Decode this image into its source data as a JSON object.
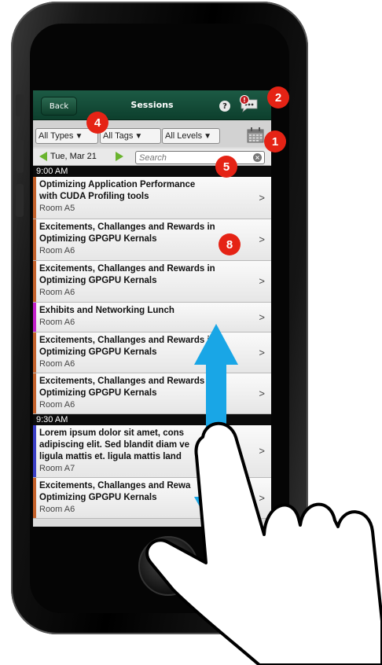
{
  "navbar": {
    "back_label": "Back",
    "title": "Sessions",
    "help_label": "?",
    "chat_badge_count": "!"
  },
  "filters": {
    "types": "All Types",
    "tags": "All Tags",
    "levels": "All Levels",
    "caret": "▼"
  },
  "date_bar": {
    "date": "Tue, Mar 21",
    "search_placeholder": "Search",
    "clear_label": "×"
  },
  "groups": [
    {
      "time": "9:00 AM",
      "sessions": [
        {
          "title_line1": "Optimizing Application Performance",
          "title_line2": "with CUDA Profiling tools",
          "title_line3": "",
          "room": "Room A5",
          "color": "#c4612a"
        },
        {
          "title_line1": "Excitements, Challanges and Rewards in",
          "title_line2": "Optimizing GPGPU Kernals",
          "title_line3": "",
          "room": "Room A6",
          "color": "#c4612a"
        },
        {
          "title_line1": "Excitements, Challanges and Rewards in",
          "title_line2": "Optimizing GPGPU Kernals",
          "title_line3": "",
          "room": "Room A6",
          "color": "#c4612a"
        },
        {
          "title_line1": "Exhibits and Networking Lunch",
          "title_line2": "",
          "title_line3": "",
          "room": "Room A6",
          "color": "#c21fc9"
        },
        {
          "title_line1": "Excitements, Challanges and Rewards in",
          "title_line2": "Optimizing GPGPU Kernals",
          "title_line3": "",
          "room": "Room A6",
          "color": "#c4612a"
        },
        {
          "title_line1": "Excitements, Challanges and Rewards in",
          "title_line2": "Optimizing GPGPU Kernals",
          "title_line3": "",
          "room": "Room A6",
          "color": "#c4612a"
        }
      ]
    },
    {
      "time": "9:30 AM",
      "sessions": [
        {
          "title_line1": "Lorem ipsum dolor sit amet, cons",
          "title_line2": "adipiscing elit. Sed blandit diam ve",
          "title_line3": "ligula mattis et.  ligula mattis land",
          "room": "Room A7",
          "color": "#3b3fc6"
        },
        {
          "title_line1": "Excitements, Challanges and Rewa",
          "title_line2": "Optimizing GPGPU Kernals",
          "title_line3": "",
          "room": "Room A6",
          "color": "#c4612a"
        }
      ]
    }
  ],
  "chevron": ">",
  "callouts": {
    "c1": "1",
    "c2": "2",
    "c4": "4",
    "c5": "5",
    "c8": "8"
  },
  "colors": {
    "navbar": "#0d3f2d",
    "callout": "#e52315",
    "scroll_arrow": "#19a6e6"
  }
}
